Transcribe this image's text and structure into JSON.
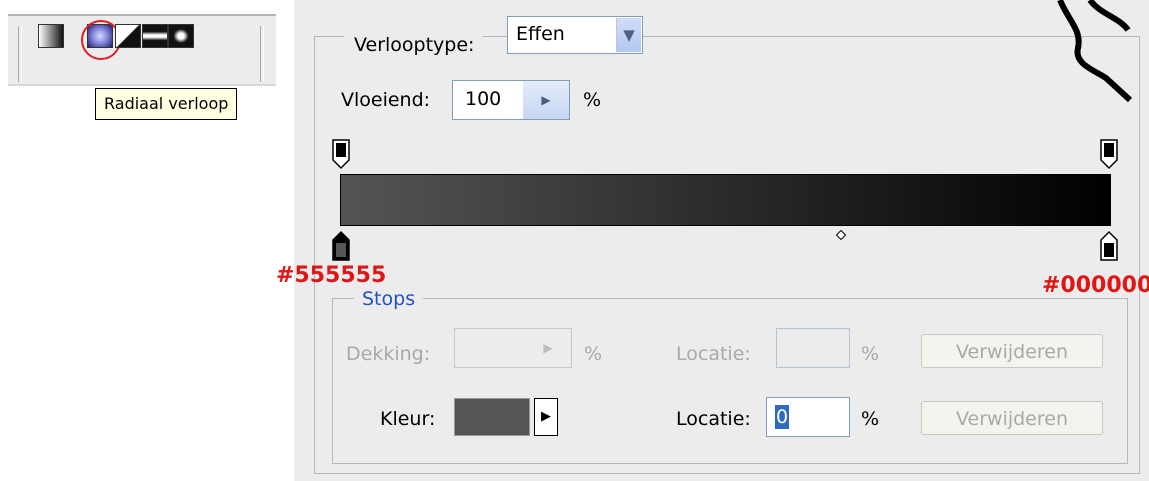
{
  "toolbar": {
    "tools": [
      {
        "name": "linear-gradient-icon"
      },
      {
        "name": "radial-gradient-icon",
        "highlighted": true
      },
      {
        "name": "angle-gradient-icon"
      },
      {
        "name": "reflected-gradient-icon"
      },
      {
        "name": "diamond-gradient-icon"
      }
    ],
    "tooltip": "Radiaal verloop",
    "highlight_color": "#e02020"
  },
  "dialog": {
    "gradient_type_label": "Verlooptype:",
    "gradient_type_value": "Effen",
    "smoothness_label": "Vloeiend:",
    "smoothness_value": "100",
    "smoothness_unit": "%",
    "gradient": {
      "start_color": "#555555",
      "end_color": "#000000",
      "midpoint_fraction": 0.65
    },
    "annotations": {
      "left_color": "#555555",
      "right_color": "#000000"
    },
    "stops": {
      "title": "Stops",
      "opacity_label": "Dekking:",
      "opacity_value": "",
      "opacity_unit": "%",
      "opacity_location_label": "Locatie:",
      "opacity_location_value": "",
      "opacity_location_unit": "%",
      "opacity_delete_label": "Verwijderen",
      "color_label": "Kleur:",
      "color_value": "#555555",
      "color_location_label": "Locatie:",
      "color_location_value": "0",
      "color_location_unit": "%",
      "color_delete_label": "Verwijderen"
    }
  }
}
